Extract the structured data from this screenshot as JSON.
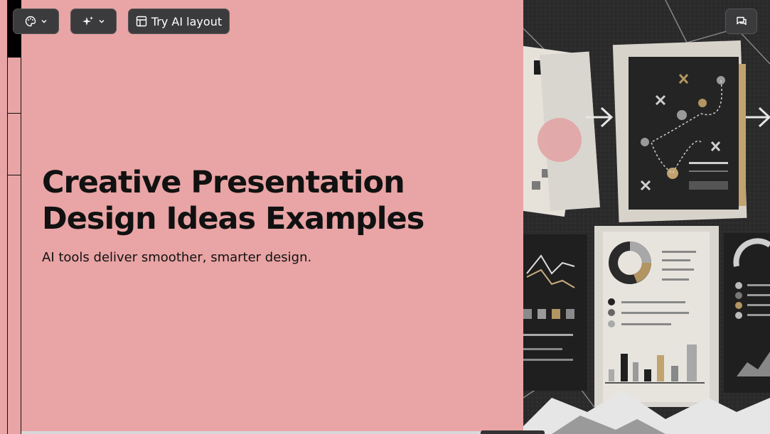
{
  "toolbar": {
    "theme_icon": "palette-icon",
    "ai_icon": "sparkle-icon",
    "layout_icon": "layout-icon",
    "try_ai_layout_label": "Try AI layout",
    "comment_icon": "comment-icon"
  },
  "slide": {
    "title": "Creative Presentation Design Ideas Examples",
    "subtitle": "AI tools deliver smoother, smarter design.",
    "background_color": "#e9a4a5"
  },
  "image": {
    "description_icon": "presentation-illustration-image"
  }
}
